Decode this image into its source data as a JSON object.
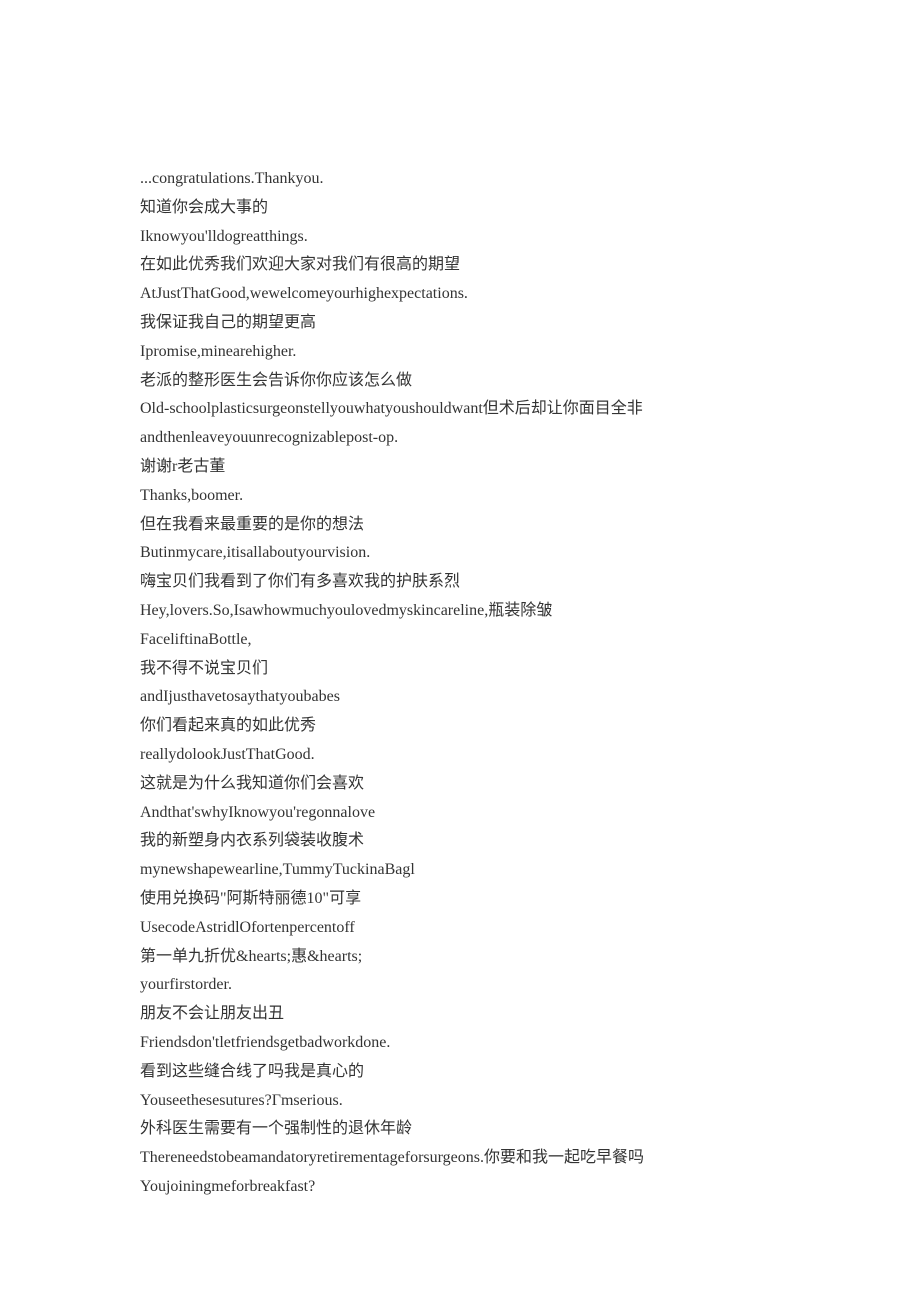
{
  "lines": [
    "...congratulations.Thankyou.",
    "知道你会成大事的",
    "Iknowyou'lldogreatthings.",
    "在如此优秀我们欢迎大家对我们有很高的期望",
    "AtJustThatGood,wewelcomeyourhighexpectations.",
    "我保证我自己的期望更高",
    "Ipromise,minearehigher.",
    "老派的整形医生会告诉你你应该怎么做",
    "Old-schoolplasticsurgeonstellyouwhatyoushouldwant但术后却让你面目全非",
    "andthenleaveyouunrecognizablepost-op.",
    "谢谢r老古董",
    "Thanks,boomer.",
    "但在我看来最重要的是你的想法",
    "Butinmycare,itisallaboutyourvision.",
    "嗨宝贝们我看到了你们有多喜欢我的护肤系烈",
    "Hey,lovers.So,Isawhowmuchyoulovedmyskincareline,瓶装除皱",
    "FaceliftinaBottle,",
    "我不得不说宝贝们",
    "andIjusthavetosaythatyoubabes",
    "你们看起来真的如此优秀",
    "reallydolookJustThatGood.",
    "这就是为什么我知道你们会喜欢",
    "Andthat'swhyIknowyou'regonnalove",
    "我的新塑身内衣系列袋装收腹术",
    "mynewshapewearline,TummyTuckinaBagl",
    "使用兑换码\"阿斯特丽德10\"可享",
    "UsecodeAstridlOfortenpercentoff",
    "第一单九折优&hearts;惠&hearts;",
    "yourfirstorder.",
    "朋友不会让朋友出丑",
    "Friendsdon'tletfriendsgetbadworkdone.",
    "看到这些缝合线了吗我是真心的",
    "Youseethesesutures?Гmserious.",
    "外科医生需要有一个强制性的退休年龄",
    "Thereneedstobeamandatoryretirementageforsurgeons.你要和我一起吃早餐吗",
    "Youjoiningmeforbreakfast?"
  ]
}
